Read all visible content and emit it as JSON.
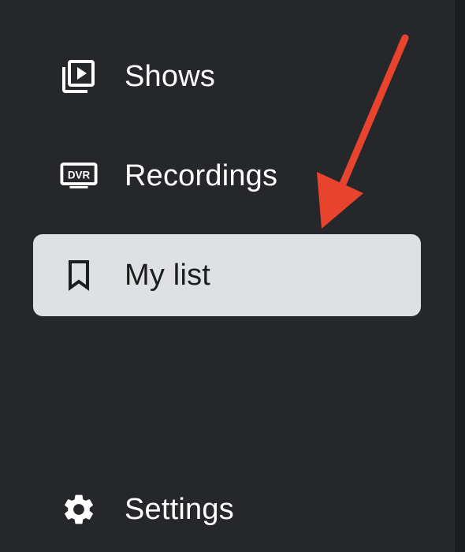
{
  "nav": {
    "items": [
      {
        "label": "Shows",
        "icon": "video-library-icon",
        "selected": false
      },
      {
        "label": "Recordings",
        "icon": "dvr-icon",
        "selected": false
      },
      {
        "label": "My list",
        "icon": "bookmark-icon",
        "selected": true
      },
      {
        "label": "Settings",
        "icon": "gear-icon",
        "selected": false
      }
    ],
    "dvr_badge": "DVR"
  },
  "colors": {
    "background": "#25272a",
    "selected_background": "#dfe0e1",
    "text": "#ffffff",
    "selected_text": "#1c1d1f",
    "annotation_arrow": "#e8432d"
  }
}
